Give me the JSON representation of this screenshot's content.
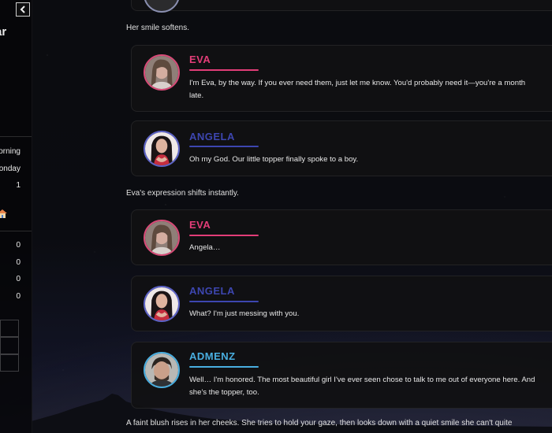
{
  "colors": {
    "eva": "#e23d78",
    "angela": "#3d46b0",
    "admenz": "#49aee0",
    "card_bg": "#111113"
  },
  "sidebar": {
    "back_icon": "chevron-left-icon",
    "title_fragment": "ar",
    "time_of_day": "orning",
    "weekday": "onday",
    "day_number": "1",
    "location_icon": "house-icon",
    "stats": [
      "0",
      "0",
      "0",
      "0"
    ]
  },
  "story": {
    "blocks": [
      {
        "kind": "narration",
        "text": "Her smile softens."
      },
      {
        "kind": "dialogue",
        "speaker": "EVA",
        "text": "I'm Eva, by the way. If you ever need them, just let me know. You'd probably need it—you're a month late."
      },
      {
        "kind": "dialogue",
        "speaker": "ANGELA",
        "text": "Oh my God. Our little topper finally spoke to a boy."
      },
      {
        "kind": "narration",
        "text": "Eva's expression shifts instantly."
      },
      {
        "kind": "dialogue",
        "speaker": "EVA",
        "text": "Angela…"
      },
      {
        "kind": "dialogue",
        "speaker": "ANGELA",
        "text": "What? I'm just messing with you."
      },
      {
        "kind": "dialogue",
        "speaker": "ADMENZ",
        "text": "Well… I'm honored. The most beautiful girl I've ever seen chose to talk to me out of everyone here. And she's the topper, too."
      },
      {
        "kind": "narration",
        "text": "A faint blush rises in her cheeks. She tries to hold your gaze, then looks down with a quiet smile she can't quite"
      }
    ]
  }
}
